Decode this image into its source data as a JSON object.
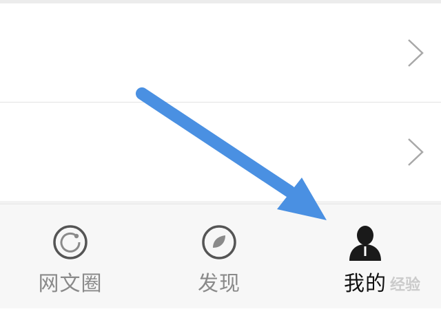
{
  "tabs": [
    {
      "label": "网文圈",
      "icon": "circle-loop-icon",
      "active": false
    },
    {
      "label": "发现",
      "icon": "compass-leaf-icon",
      "active": false
    },
    {
      "label": "我的",
      "icon": "person-icon",
      "active": true
    }
  ],
  "colors": {
    "active": "#111111",
    "inactive": "#8a8a8a",
    "annotation_arrow": "#4a90e2"
  },
  "watermark": "经验"
}
